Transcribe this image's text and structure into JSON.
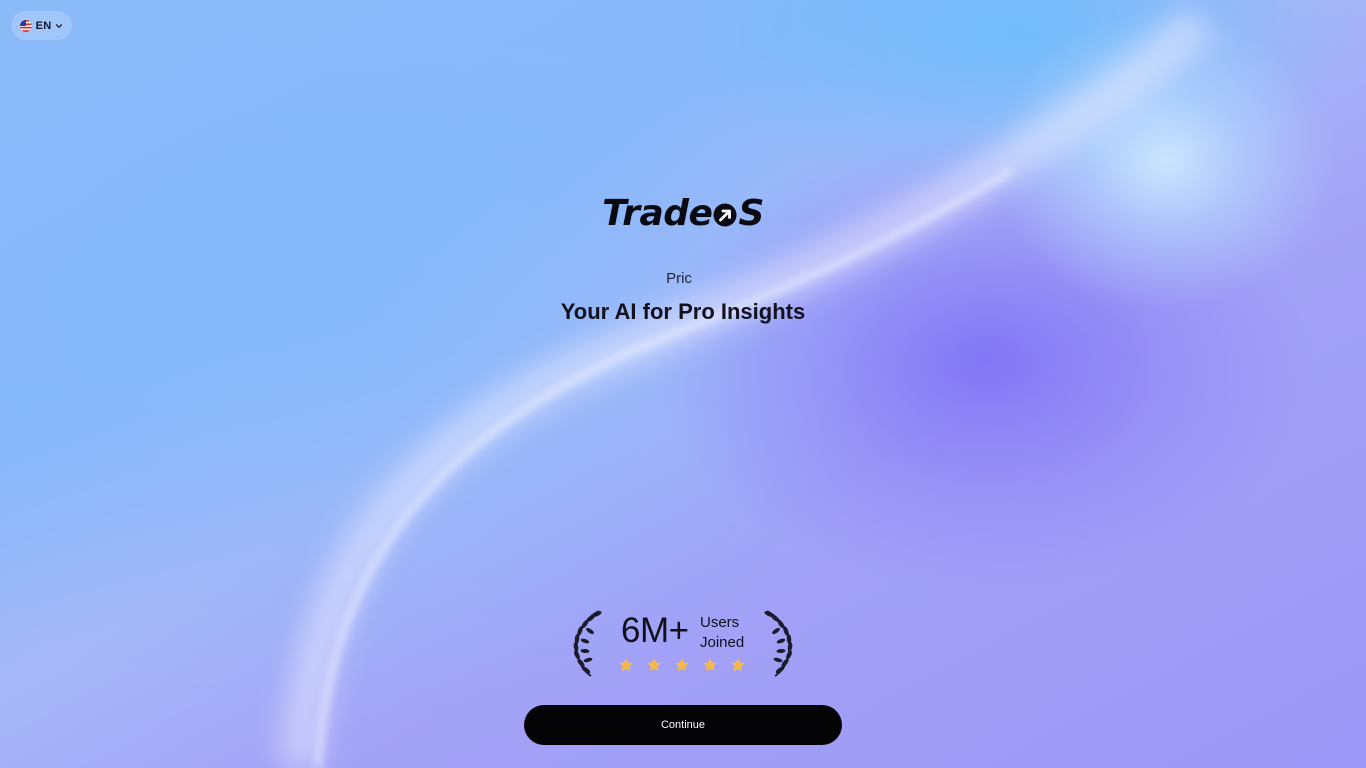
{
  "language": {
    "code": "EN",
    "flag_icon": "us-flag-icon"
  },
  "brand": {
    "part1": "Trade",
    "part2": "S"
  },
  "product_name": "Pric",
  "tagline": "Your AI for Pro Insights",
  "social_proof": {
    "count": "6M+",
    "label_line1": "Users",
    "label_line2": "Joined",
    "rating": 5
  },
  "cta": {
    "label": "Continue"
  },
  "colors": {
    "button_bg": "#040407",
    "star": "#f6b94a"
  }
}
